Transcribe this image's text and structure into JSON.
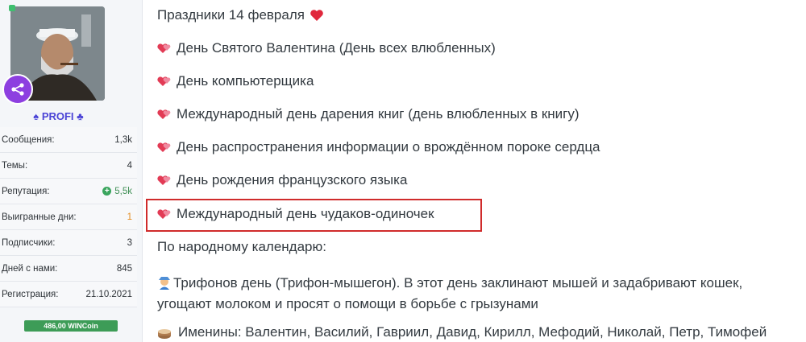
{
  "sidebar": {
    "rank_label": "♠ PROFI ♣",
    "stats": [
      {
        "label": "Сообщения:",
        "value": "1,3k"
      },
      {
        "label": "Темы:",
        "value": "4"
      },
      {
        "label": "Репутация:",
        "value": "5,5k"
      },
      {
        "label": "Выигранные дни:",
        "value": "1"
      },
      {
        "label": "Подписчики:",
        "value": "3"
      },
      {
        "label": "Дней с нами:",
        "value": "845"
      },
      {
        "label": "Регистрация:",
        "value": "21.10.2021"
      }
    ],
    "wincoin": "486,00 WINCoin"
  },
  "content": {
    "title": "Праздники 14 февраля",
    "holidays": [
      "День Святого Валентина (День всех влюбленных)",
      "День компьютерщика",
      "Международный день дарения книг (день влюбленных в книгу)",
      "День распространения информации о врождённом пороке сердца",
      "День рождения французского языка",
      "Международный день чудаков-одиночек"
    ],
    "folk_title": "По народному календарю:",
    "folk_line1": "Трифонов день (Трифон-мышегон). В этот день заклинают мышей и задабривают кошек,",
    "folk_line2": "угощают молоком и просят о помощи в борьбе с грызунами",
    "namedays": "Именины: Валентин, Василий, Гавриил, Давид, Кирилл, Мефодий, Николай, Петр, Тимофей"
  },
  "colors": {
    "accent": "#4b44d6",
    "badge": "#8d3fe0",
    "highlight": "#d02b2b",
    "wincoin": "#3d9c57"
  }
}
